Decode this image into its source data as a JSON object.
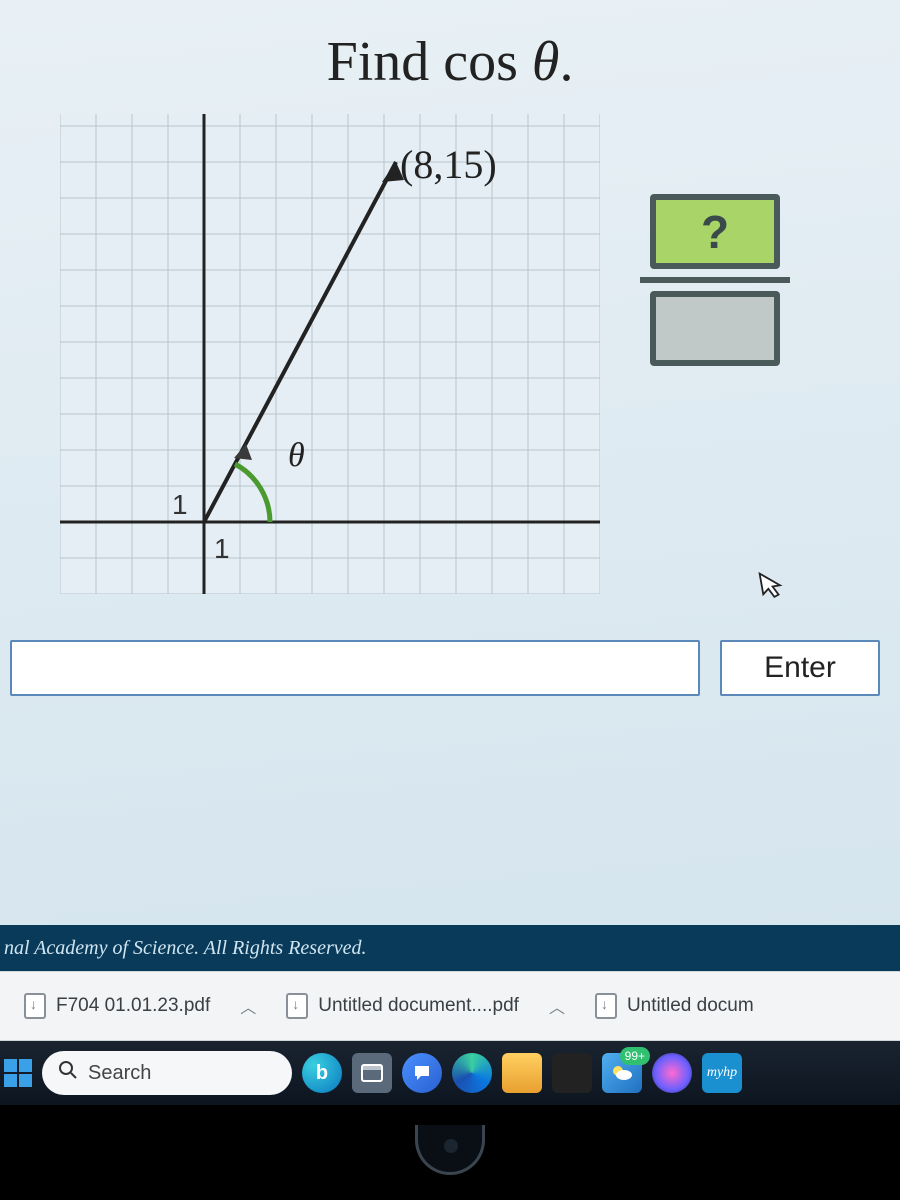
{
  "problem": {
    "title_prefix": "Find cos ",
    "title_var": "θ",
    "title_suffix": ".",
    "point_label": "(8,15)",
    "angle_label": "θ",
    "axis_tick_x": "1",
    "axis_tick_y": "1",
    "numerator_placeholder": "?",
    "enter_label": "Enter"
  },
  "footer": {
    "copyright": "nal Academy of Science. All Rights Reserved."
  },
  "downloads": [
    {
      "name": "F704 01.01.23.pdf"
    },
    {
      "name": "Untitled document....pdf"
    },
    {
      "name": "Untitled docum"
    }
  ],
  "taskbar": {
    "search_placeholder": "Search",
    "bing_letter": "b",
    "badge": "99+",
    "myhp": "myhp"
  }
}
